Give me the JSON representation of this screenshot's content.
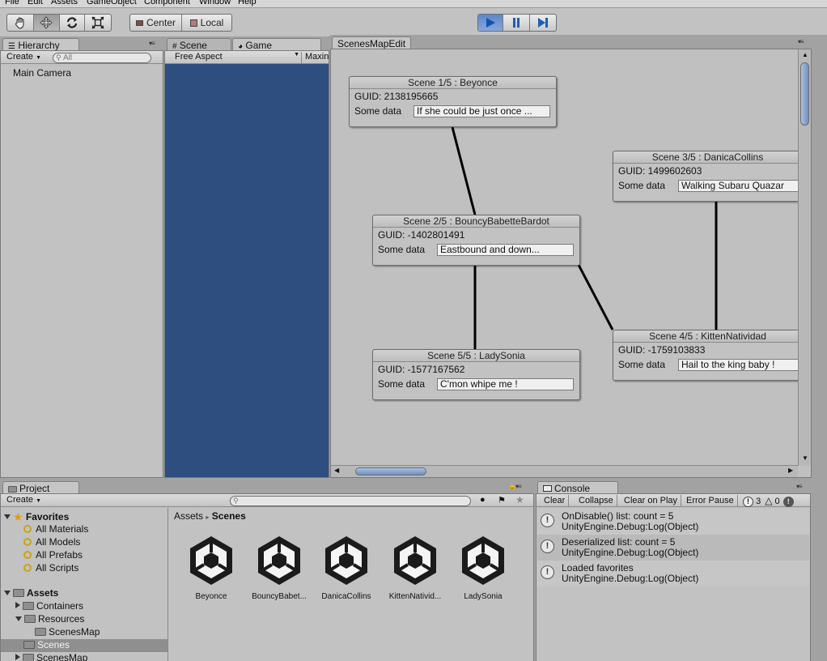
{
  "menu": [
    "File",
    "Edit",
    "Assets",
    "GameObject",
    "Component",
    "Window",
    "Help"
  ],
  "toolbar": {
    "tools": [
      "hand-icon",
      "move-icon",
      "rotate-icon",
      "scale-icon"
    ],
    "pivot": "Center",
    "space": "Local",
    "play": [
      "play-icon",
      "pause-icon",
      "step-icon"
    ]
  },
  "hierarchy": {
    "tab": "Hierarchy",
    "create": "Create",
    "search_placeholder": "All",
    "items": [
      "Main Camera"
    ]
  },
  "scene_game": {
    "tabs": [
      "Scene",
      "Game"
    ],
    "aspect": "Free Aspect",
    "maximize": "Maxin"
  },
  "scenes_map": {
    "tab": "ScenesMapEdit",
    "nodes": [
      {
        "title": "Scene 1/5 : Beyonce",
        "guid": "GUID: 2138195665",
        "label": "Some data",
        "value": "If she could be just once ..."
      },
      {
        "title": "Scene 2/5 : BouncyBabetteBardot",
        "guid": "GUID: -1402801491",
        "label": "Some data",
        "value": "Eastbound and down..."
      },
      {
        "title": "Scene 3/5 : DanicaCollins",
        "guid": "GUID: 1499602603",
        "label": "Some data",
        "value": "Walking Subaru Quazar"
      },
      {
        "title": "Scene 4/5 : KittenNatividad",
        "guid": "GUID: -1759103833",
        "label": "Some data",
        "value": "Hail to the king baby !"
      },
      {
        "title": "Scene 5/5 : LadySonia",
        "guid": "GUID: -1577167562",
        "label": "Some data",
        "value": "C'mon whipe me !"
      }
    ]
  },
  "project": {
    "tab": "Project",
    "create": "Create",
    "breadcrumb_root": "Assets",
    "breadcrumb_sep": "▸",
    "breadcrumb_current": "Scenes",
    "favorites_label": "Favorites",
    "favorites": [
      "All Materials",
      "All Models",
      "All Prefabs",
      "All Scripts"
    ],
    "assets_label": "Assets",
    "tree": [
      "Containers",
      "Resources",
      "ScenesMap",
      "Scenes",
      "ScenesMap"
    ],
    "files": [
      "Beyonce",
      "BouncyBabet...",
      "DanicaCollins",
      "KittenNativid...",
      "LadySonia"
    ]
  },
  "console": {
    "tab": "Console",
    "buttons": [
      "Clear",
      "Collapse",
      "Clear on Play",
      "Error Pause"
    ],
    "warn_count": "3",
    "warn2_count": "0",
    "entries": [
      {
        "line1": "OnDisable() list: count = 5",
        "line2": "UnityEngine.Debug:Log(Object)"
      },
      {
        "line1": "Deserialized list: count = 5",
        "line2": "UnityEngine.Debug:Log(Object)"
      },
      {
        "line1": "Loaded favorites",
        "line2": "UnityEngine.Debug:Log(Object)"
      }
    ]
  }
}
